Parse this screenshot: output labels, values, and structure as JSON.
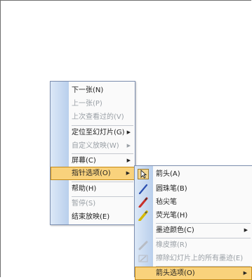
{
  "context_menu": {
    "items": [
      {
        "label": "下一张(N)",
        "disabled": false
      },
      {
        "label": "上一张(P)",
        "disabled": true
      },
      {
        "label": "上次查看过的(V)",
        "disabled": true
      },
      {
        "label": "定位至幻灯片(G)",
        "disabled": false,
        "submenu": true
      },
      {
        "label": "自定义放映(W)",
        "disabled": true,
        "submenu": true
      },
      {
        "label": "屏幕(C)",
        "disabled": false,
        "submenu": true
      },
      {
        "label": "指针选项(O)",
        "disabled": false,
        "submenu": true,
        "active": true
      },
      {
        "label": "帮助(H)",
        "disabled": false
      },
      {
        "label": "暂停(S)",
        "disabled": true
      },
      {
        "label": "结束放映(E)",
        "disabled": false
      }
    ]
  },
  "pointer_submenu": {
    "items": [
      {
        "label": "箭头(A)",
        "icon": "arrow-cursor-icon"
      },
      {
        "label": "圆珠笔(B)",
        "icon": "ballpoint-pen-icon"
      },
      {
        "label": "毡尖笔",
        "icon": "felt-tip-pen-icon"
      },
      {
        "label": "荧光笔(H)",
        "icon": "highlighter-icon"
      },
      {
        "label": "墨迹颜色(C)",
        "submenu": true
      },
      {
        "label": "橡皮擦(R)",
        "disabled": true,
        "icon": "eraser-icon"
      },
      {
        "label": "擦除幻灯片上的所有墨迹(E)",
        "disabled": true,
        "icon": "erase-all-icon"
      },
      {
        "label": "箭头选项(O)",
        "submenu": true,
        "active": true
      }
    ]
  },
  "colors": {
    "accent_highlight": "#f9d27c",
    "ballpoint": "#2b4fb0",
    "felt_tip": "#c8302a",
    "highlighter": "#d4b800"
  },
  "submenu_arrow": "▶"
}
